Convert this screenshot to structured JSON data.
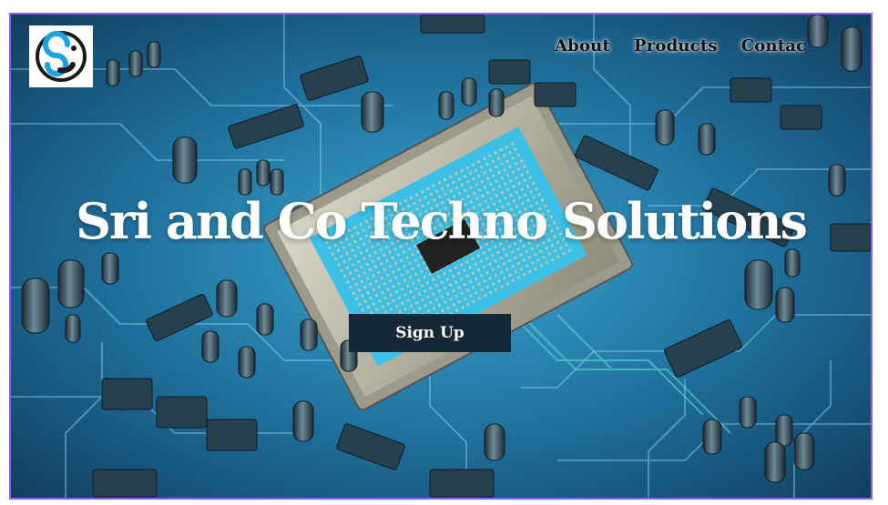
{
  "brand": {
    "logo_icon": "sc-logo-icon",
    "colors": {
      "accent": "#1aa3e0",
      "dark": "#1a1a1a"
    }
  },
  "nav": {
    "items": [
      {
        "label": "About"
      },
      {
        "label": "Products"
      },
      {
        "label": "Contac"
      }
    ]
  },
  "hero": {
    "title": "Sri and Co Techno Solutions",
    "cta_label": "Sign Up",
    "background": "circuit-board-image"
  },
  "colors": {
    "frame_border": "#8b5cf6",
    "button_bg": "#142838"
  }
}
